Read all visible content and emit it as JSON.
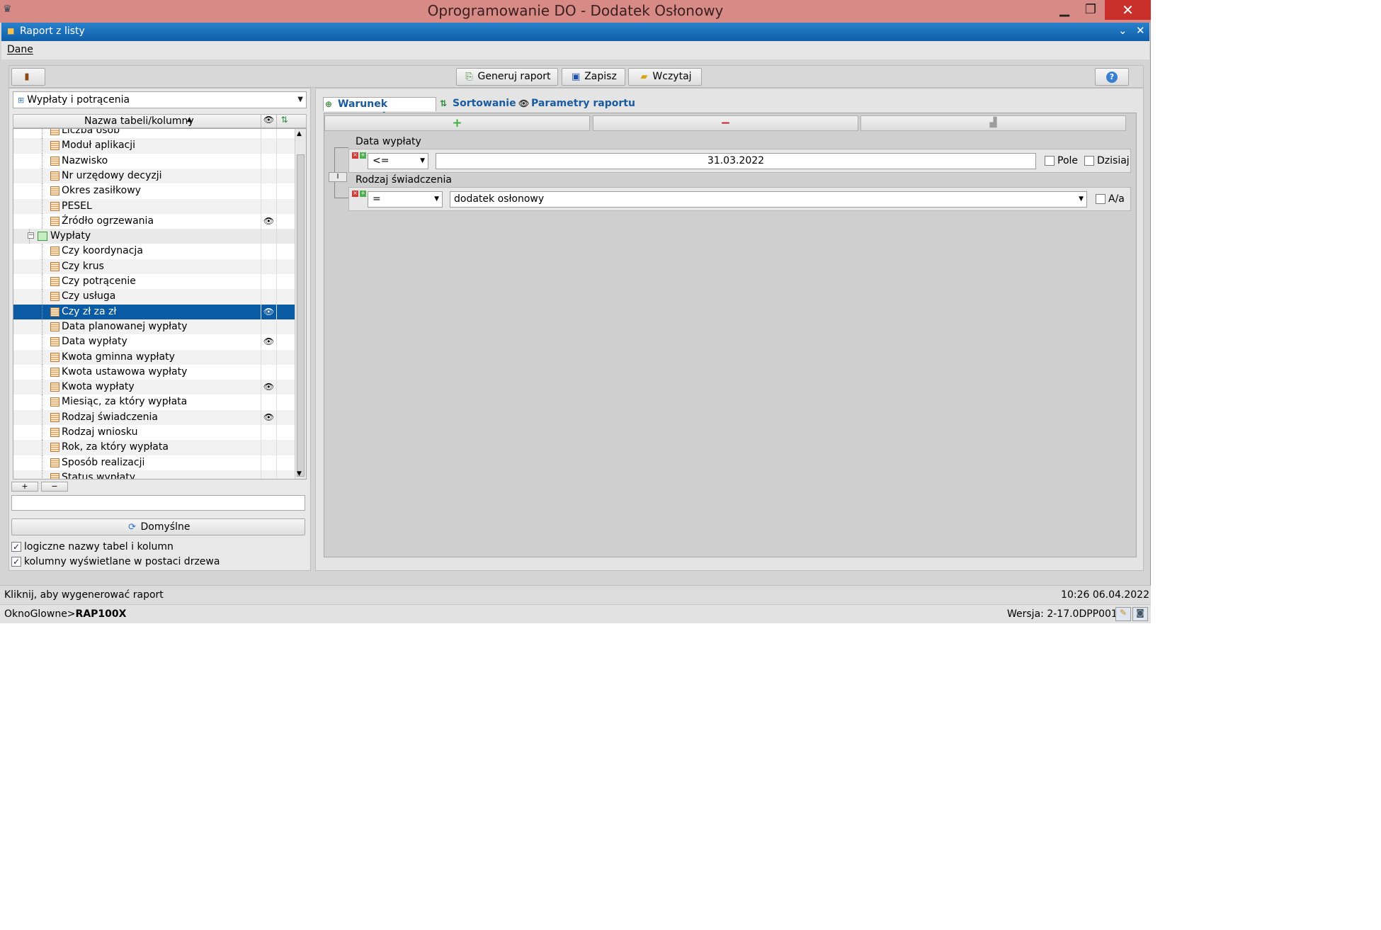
{
  "window": {
    "title": "Oprogramowanie DO - Dodatek Osłonowy",
    "min_glyph": "▁",
    "max_glyph": "❐",
    "close_glyph": "✕"
  },
  "subwindow": {
    "title": "Raport z listy",
    "collapse_glyph": "⌄",
    "close_glyph": "✕"
  },
  "menu": {
    "dane": "Dane"
  },
  "toolbar": {
    "generate_label": "Generuj raport",
    "save_label": "Zapisz",
    "load_label": "Wczytaj",
    "help_glyph": "?"
  },
  "left": {
    "source_select": "Wypłaty i potrącenia",
    "tree_header": "Nazwa tabeli/kolumny",
    "tree_items": [
      {
        "label": "Liczba osób"
      },
      {
        "label": "Moduł aplikacji"
      },
      {
        "label": "Nazwisko"
      },
      {
        "label": "Nr urzędowy decyzji"
      },
      {
        "label": "Okres zasiłkowy"
      },
      {
        "label": "PESEL"
      },
      {
        "label": "Źródło ogrzewania",
        "visible": "👁"
      },
      {
        "label": "Wypłaty",
        "group": true
      },
      {
        "label": "Czy koordynacja"
      },
      {
        "label": "Czy krus"
      },
      {
        "label": "Czy potrącenie"
      },
      {
        "label": "Czy usługa"
      },
      {
        "label": "Czy zł za zł",
        "visible": "👁",
        "selected": true
      },
      {
        "label": "Data planowanej wypłaty"
      },
      {
        "label": "Data wypłaty",
        "visible": "👁"
      },
      {
        "label": "Kwota gminna wypłaty"
      },
      {
        "label": "Kwota ustawowa wypłaty"
      },
      {
        "label": "Kwota wypłaty",
        "visible": "👁"
      },
      {
        "label": "Miesiąc, za który wypłata"
      },
      {
        "label": "Rodzaj świadczenia",
        "visible": "👁"
      },
      {
        "label": "Rodzaj wniosku"
      },
      {
        "label": "Rok, za który wypłata"
      },
      {
        "label": "Sposób realizacji"
      },
      {
        "label": "Status wypłaty"
      }
    ],
    "plus_glyph": "+",
    "minus_glyph": "−",
    "search_value": "",
    "default_button": "Domyślne",
    "checkbox1_label": "logiczne nazwy tabel i kolumn",
    "checkbox2_label": "kolumny wyświetlane w postaci drzewa",
    "checkbox1_checked": true,
    "checkbox2_checked": true
  },
  "right": {
    "tabs": [
      "Warunek zapytania",
      "Sortowanie",
      "Parametry raportu"
    ],
    "add_glyph": "+",
    "remove_glyph": "−",
    "conditions": [
      {
        "field": "Data wypłaty",
        "operator": "<=",
        "value": "31.03.2022",
        "opt1": "Pole",
        "opt2": "Dzisiaj"
      },
      {
        "field": "Rodzaj świadczenia",
        "operator": "=",
        "value": "dodatek osłonowy",
        "opt1": "A/a"
      }
    ],
    "logic_op": "I"
  },
  "status": {
    "hint": "Kliknij, aby wygenerować raport",
    "datetime": "10:26 06.04.2022",
    "path_prefix": "OknoGlowne>",
    "path_bold": "RAP100X",
    "version": "Wersja: 2-17.0DPP001"
  },
  "colors": {
    "selection": "#0b5ba4",
    "titlebar": "#d88a86",
    "subbar": "#1566b4",
    "close": "#c9302c"
  }
}
